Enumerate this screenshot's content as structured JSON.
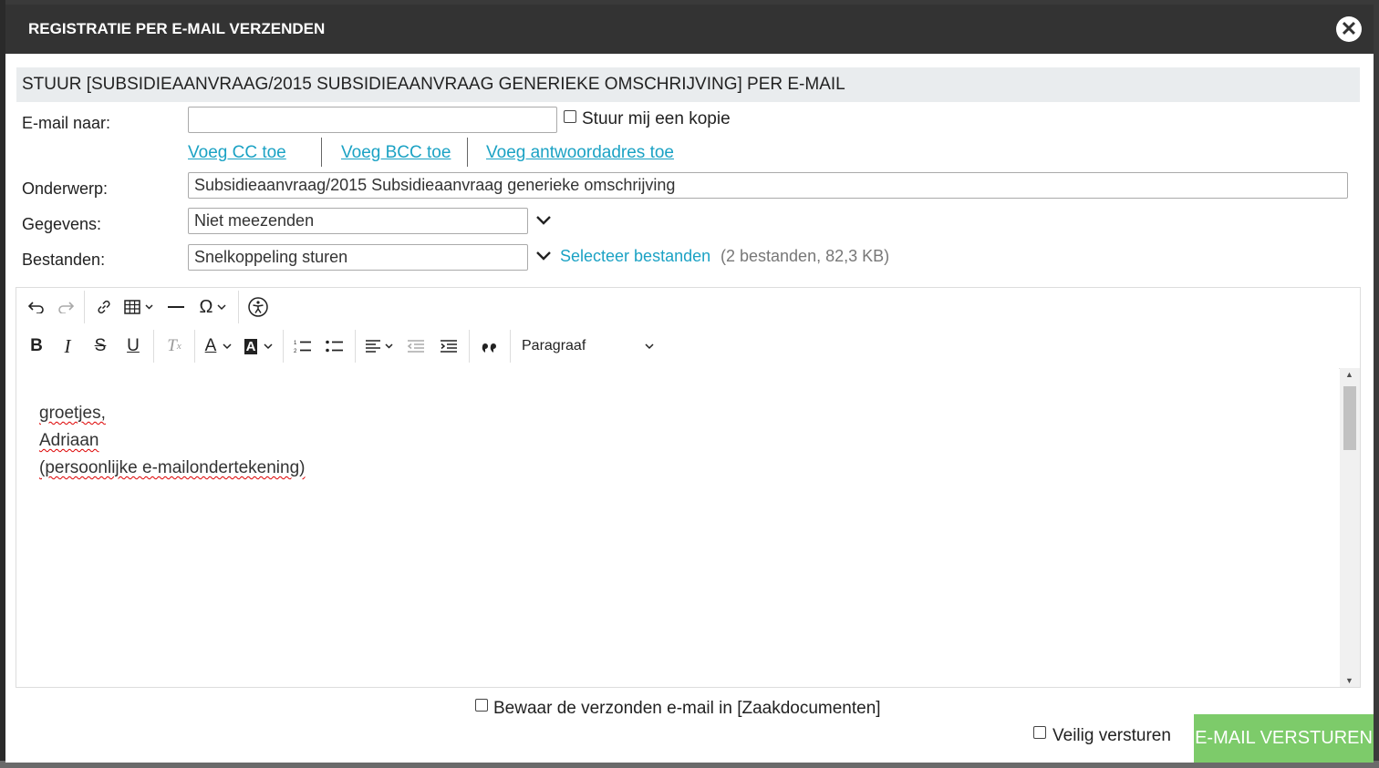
{
  "dialog": {
    "title": "REGISTRATIE PER E-MAIL VERZENDEN",
    "close_icon": "close-icon"
  },
  "section": {
    "title": "STUUR [SUBSIDIEAANVRAAG/2015 SUBSIDIEAANVRAAG GENERIEKE OMSCHRIJVING] PER E-MAIL"
  },
  "form": {
    "email_to": {
      "label": "E-mail naar:",
      "value": "",
      "copy_label": "Stuur mij een kopie"
    },
    "links": {
      "cc": "Voeg CC toe",
      "bcc": "Voeg BCC toe",
      "reply_to": "Voeg antwoordadres toe"
    },
    "subject": {
      "label": "Onderwerp:",
      "value": "Subsidieaanvraag/2015 Subsidieaanvraag generieke omschrijving"
    },
    "data": {
      "label": "Gegevens:",
      "value": "Niet meezenden"
    },
    "files": {
      "label": "Bestanden:",
      "value": "Snelkoppeling sturen",
      "select_link": "Selecteer bestanden",
      "info": "(2 bestanden, 82,3 KB)"
    }
  },
  "editor": {
    "paragraph_format": "Paragraaf",
    "lines": [
      "groetjes,",
      "Adriaan",
      "(persoonlijke e-mailondertekening)"
    ]
  },
  "footer": {
    "save_label": "Bewaar de verzonden e-mail in [Zaakdocumenten]",
    "secure_label": "Veilig versturen",
    "send_label": "E-MAIL VERSTUREN"
  },
  "colors": {
    "header_bg": "#333333",
    "link": "#1ba2c4",
    "send_button": "#7dcb6a",
    "section_bg": "#e9ecee"
  }
}
